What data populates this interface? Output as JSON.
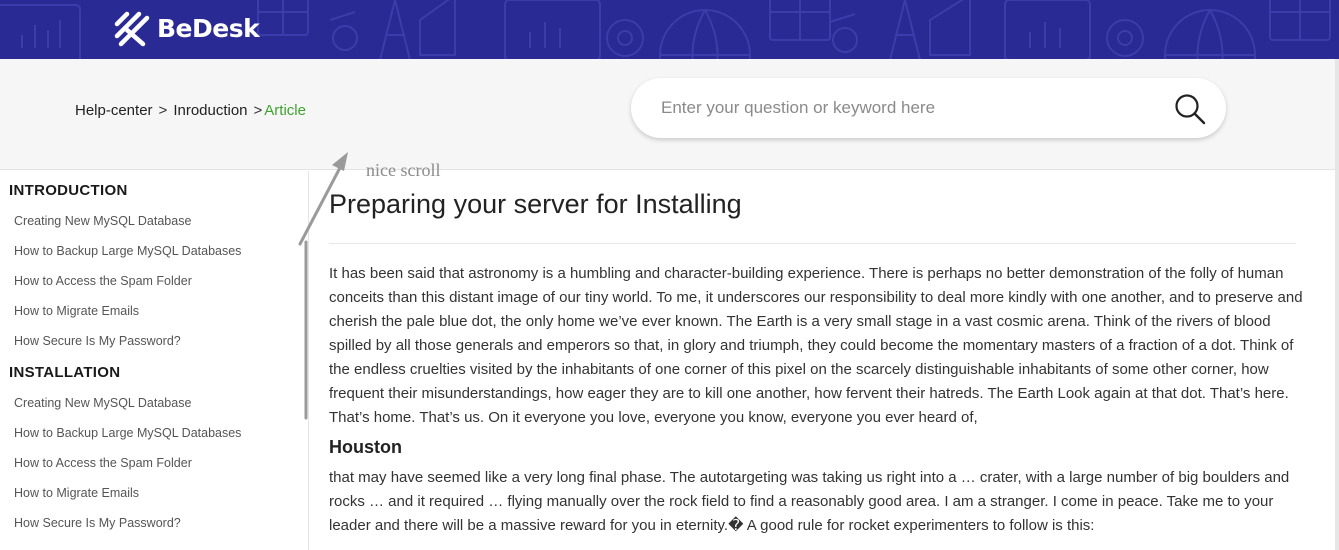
{
  "header": {
    "logo_text": "BeDesk",
    "bg_color": "#2a2a94",
    "logo_icon": "bedesk-logo-icon"
  },
  "breadcrumb": {
    "items": [
      "Help-center",
      "Inroduction"
    ],
    "separator": ">",
    "current": "Article",
    "current_color": "#3fa32e"
  },
  "search": {
    "placeholder": "Enter your question or keyword here",
    "value": "",
    "icon": "search-icon"
  },
  "annotation": {
    "text": "nice scroll"
  },
  "sidebar": {
    "sections": [
      {
        "title": "INTRODUCTION",
        "links": [
          "Creating New MySQL Database",
          "How to Backup Large MySQL Databases",
          "How to Access the Spam Folder",
          "How to Migrate Emails",
          "How Secure Is My Password?"
        ]
      },
      {
        "title": "INSTALLATION",
        "links": [
          "Creating New MySQL Database",
          "How to Backup Large MySQL Databases",
          "How to Access the Spam Folder",
          "How to Migrate Emails",
          "How Secure Is My Password?"
        ]
      }
    ]
  },
  "article": {
    "title": "Preparing your server for Installing",
    "paragraph_1": "It has been said that astronomy is a humbling and character-building experience. There is perhaps no better demonstration of the folly of human conceits than this distant image of our tiny world. To me, it underscores our responsibility to deal more kindly with one another, and to preserve and cherish the pale blue dot, the only home we’ve ever known. The Earth is a very small stage in a vast cosmic arena. Think of the rivers of blood spilled by all those generals and emperors so that, in glory and triumph, they could become the momentary masters of a fraction of a dot. Think of the endless cruelties visited by the inhabitants of one corner of this pixel on the scarcely distinguishable inhabitants of some other corner, how frequent their misunderstandings, how eager they are to kill one another, how fervent their hatreds. The Earth Look again at that dot. That’s here. That’s home. That’s us. On it everyone you love, everyone you know, everyone you ever heard of,",
    "subtitle": "Houston",
    "paragraph_2": "that may have seemed like a very long final phase. The autotargeting was taking us right into a … crater, with a large number of big boulders and rocks … and it required … flying manually over the rock field to find a reasonably good area. I am a stranger. I come in peace. Take me to your leader and there will be a massive reward for you in eternity.� A good rule for rocket experimenters to follow is this:"
  }
}
